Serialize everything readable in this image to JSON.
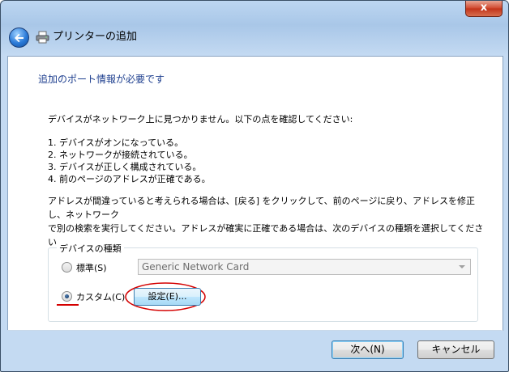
{
  "window": {
    "title": "プリンターの追加",
    "close_label": "x"
  },
  "icons": {
    "back": "back-arrow-icon",
    "printer": "printer-icon"
  },
  "content": {
    "heading": "追加のポート情報が必要です",
    "intro": "デバイスがネットワーク上に見つかりません。以下の点を確認してください:",
    "checklist": [
      "1.  デバイスがオンになっている。",
      "2.  ネットワークが接続されている。",
      "3.  デバイスが正しく構成されている。",
      "4. 前のページのアドレスが正確である。"
    ],
    "note_line1": "アドレスが間違っていると考えられる場合は、[戻る] をクリックして、前のページに戻り、アドレスを修正し、ネットワーク",
    "note_line2": "で別の検索を実行してください。アドレスが確実に正確である場合は、次のデバイスの種類を選択してください。"
  },
  "device_type": {
    "group_label": "デバイスの種類",
    "standard_label": "標準(S)",
    "custom_label": "カスタム(C)",
    "selected": "custom",
    "standard_select_value": "Generic Network Card",
    "settings_button": "設定(E)..."
  },
  "footer": {
    "next_button": "次へ(N)",
    "cancel_button": "キャンセル"
  },
  "colors": {
    "heading": "#1e3f8f",
    "annotation": "#d40000"
  }
}
